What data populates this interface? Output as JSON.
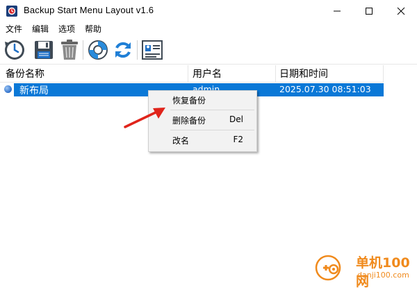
{
  "window": {
    "title": "Backup Start Menu Layout v1.6",
    "accent": "#0a78d7"
  },
  "menu": {
    "items": [
      "文件",
      "编辑",
      "选项",
      "帮助"
    ]
  },
  "toolbar": {
    "buttons": [
      "backup-clock-icon",
      "save-icon",
      "trash-icon",
      "lifebuoy-icon",
      "refresh-icon",
      "id-card-icon"
    ]
  },
  "list": {
    "columns": [
      "备份名称",
      "用户名",
      "日期和时间"
    ],
    "rows": [
      {
        "name": "新布局",
        "user": "admin",
        "datetime": "2025.07.30 08:51:03",
        "selected": true
      }
    ]
  },
  "context_menu": {
    "items": [
      {
        "label": "恢复备份",
        "shortcut": ""
      },
      {
        "label": "删除备份",
        "shortcut": "Del"
      },
      {
        "label": "改名",
        "shortcut": "F2"
      }
    ]
  },
  "watermark": {
    "text": "单机100网",
    "url_text": "danji100.com"
  }
}
